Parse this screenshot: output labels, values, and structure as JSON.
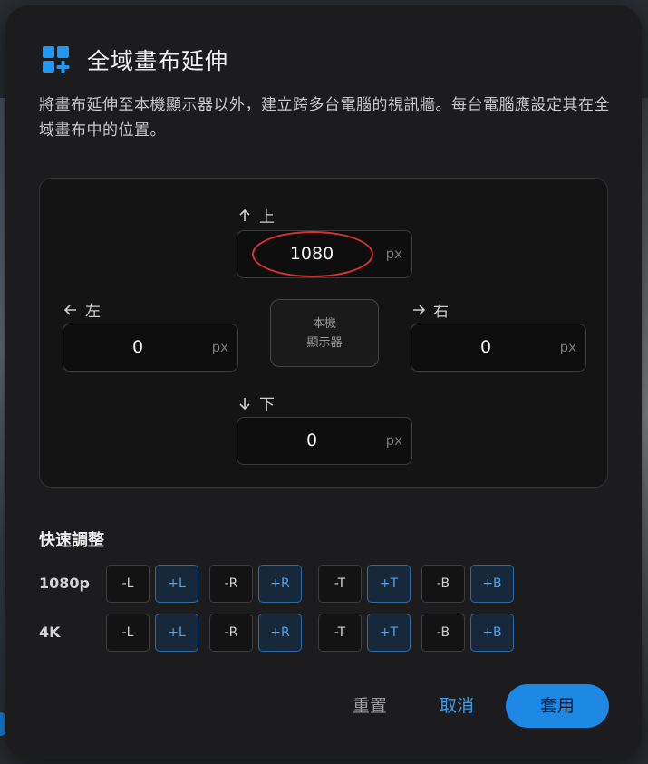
{
  "dialog": {
    "title": "全域畫布延伸",
    "description": "將畫布延伸至本機顯示器以外，建立跨多台電腦的視訊牆。每台電腦應設定其在全域畫布中的位置。"
  },
  "canvas": {
    "top": {
      "label": "上",
      "value": "1080",
      "unit": "px"
    },
    "left": {
      "label": "左",
      "value": "0",
      "unit": "px"
    },
    "right": {
      "label": "右",
      "value": "0",
      "unit": "px"
    },
    "bottom": {
      "label": "下",
      "value": "0",
      "unit": "px"
    },
    "monitor": {
      "line1": "本機",
      "line2": "顯示器"
    }
  },
  "quick": {
    "title": "快速調整",
    "rows": [
      {
        "label": "1080p",
        "buttons": [
          "-L",
          "+L",
          "-R",
          "+R",
          "-T",
          "+T",
          "-B",
          "+B"
        ]
      },
      {
        "label": "4K",
        "buttons": [
          "-L",
          "+L",
          "-R",
          "+R",
          "-T",
          "+T",
          "-B",
          "+B"
        ]
      }
    ]
  },
  "footer": {
    "reset": "重置",
    "cancel": "取消",
    "apply": "套用"
  },
  "colors": {
    "accent": "#1e88e5",
    "annotation": "#d63232"
  }
}
